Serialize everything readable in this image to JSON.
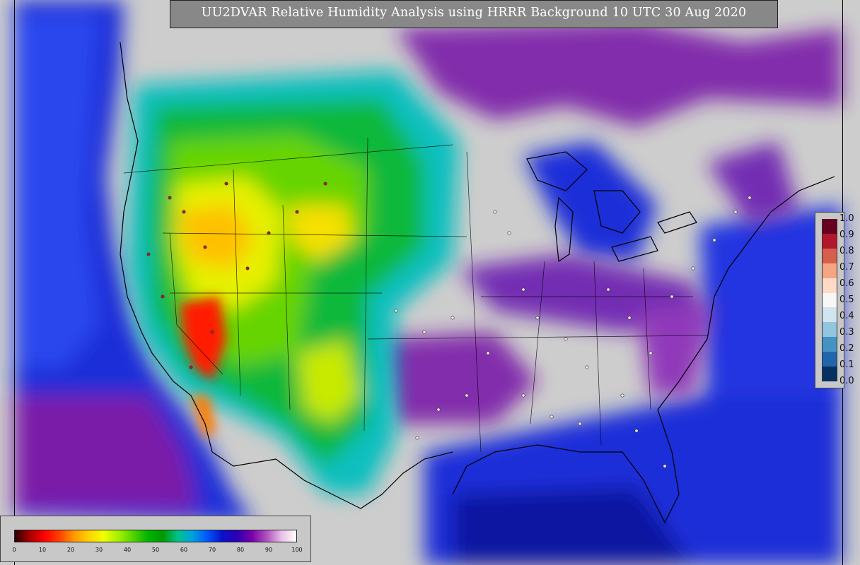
{
  "title": "UU2DVAR Relative Humidity Analysis using HRRR Background 10 UTC 30 Aug 2020",
  "colors": {
    "background_gray": "#cdcdcd",
    "ocean_blue": "#1b2fd8",
    "title_box": "#888888",
    "coastline": "#000000"
  },
  "station_colorbar": {
    "labels": [
      "1.0",
      "0.9",
      "0.8",
      "0.7",
      "0.6",
      "0.5",
      "0.4",
      "0.3",
      "0.2",
      "0.1",
      "0.0"
    ],
    "colors": [
      "#67001f",
      "#b2182b",
      "#d6604d",
      "#f4a582",
      "#fddbc7",
      "#f7f7f7",
      "#d1e5f0",
      "#92c5de",
      "#4393c3",
      "#2166ac",
      "#053061"
    ]
  },
  "rh_colorbar": {
    "ticks": [
      "0",
      "10",
      "20",
      "30",
      "40",
      "50",
      "60",
      "70",
      "80",
      "90",
      "100"
    ],
    "stops": [
      "#2a0000",
      "#aa0000",
      "#ff0000",
      "#ff4000",
      "#ff9900",
      "#ffd200",
      "#f0ff00",
      "#a6f000",
      "#4fd400",
      "#00b400",
      "#009a00",
      "#00c28a",
      "#00a0e0",
      "#0055ff",
      "#0a12c8",
      "#2a00b4",
      "#7a00aa",
      "#b050c0",
      "#e8c0e8",
      "#ffffff"
    ]
  }
}
